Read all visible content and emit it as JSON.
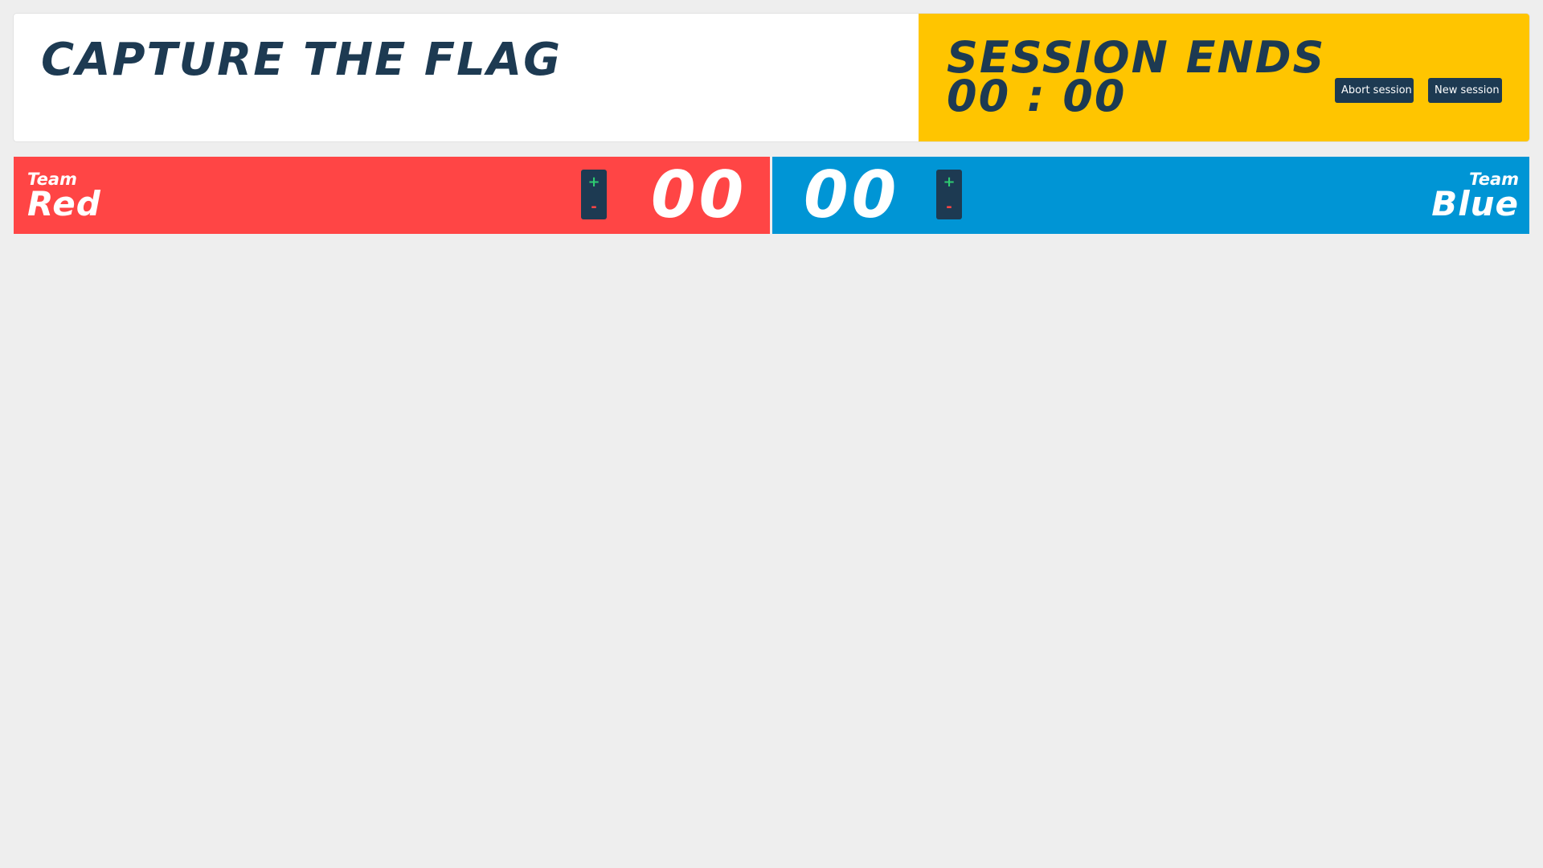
{
  "header": {
    "title": "CAPTURE THE FLAG",
    "session_label": "SESSION ENDS",
    "session_timer": "00 : 00",
    "abort_button": "Abort session",
    "new_button": "New session"
  },
  "teams": [
    {
      "prefix": "Team",
      "name": "Red",
      "score": "00",
      "plus_label": "+",
      "minus_label": "-",
      "color": "#ff4545"
    },
    {
      "prefix": "Team",
      "name": "Blue",
      "score": "00",
      "plus_label": "+",
      "minus_label": "-",
      "color": "#0095d5"
    }
  ],
  "colors": {
    "background": "#eeeeee",
    "header_accent": "#ffc500",
    "dark": "#1d3a52",
    "plus": "#2ecc71",
    "minus": "#ff4545"
  }
}
